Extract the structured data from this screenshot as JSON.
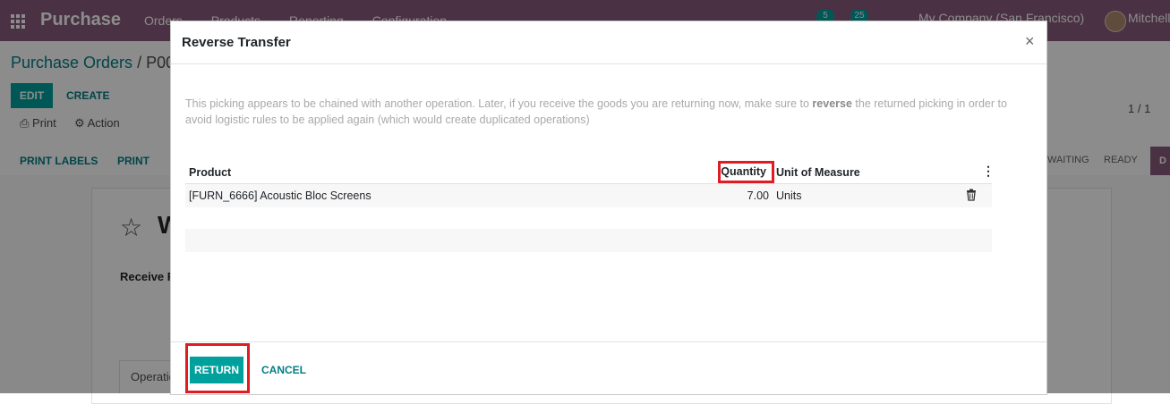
{
  "navbar": {
    "app_name": "Purchase",
    "menu": [
      "Orders",
      "Products",
      "Reporting",
      "Configuration"
    ],
    "messages_count": "5",
    "activities_count": "25",
    "company": "My Company (San Francisco)",
    "user": "Mitchell"
  },
  "control_panel": {
    "breadcrumb_parent": "Purchase Orders",
    "breadcrumb_sep": "/",
    "breadcrumb_current": "P00",
    "edit_label": "EDIT",
    "create_label": "CREATE",
    "print_label": "Print",
    "action_label": "Action",
    "pager": "1 / 1"
  },
  "statusbar": {
    "buttons": [
      "PRINT LABELS",
      "PRINT"
    ],
    "stages": [
      "WAITING",
      "READY",
      "D"
    ]
  },
  "sheet": {
    "title": "W",
    "receive_label": "Receive F",
    "tab_label": "Operatio"
  },
  "modal": {
    "title": "Reverse Transfer",
    "info_before": "This picking appears to be chained with another operation. Later, if you receive the goods you are returning now, make sure to ",
    "info_bold": "reverse",
    "info_after": " the returned picking in order to avoid logistic rules to be applied again (which would create duplicated operations)",
    "table": {
      "columns": [
        "Product",
        "Quantity",
        "Unit of Measure"
      ],
      "rows": [
        {
          "product": "[FURN_6666] Acoustic Bloc Screens",
          "quantity": "7.00",
          "uom": "Units"
        }
      ]
    },
    "return_label": "RETURN",
    "cancel_label": "CANCEL"
  },
  "colors": {
    "navbar": "#875a7b",
    "primary": "#00a09d",
    "highlight": "#e11b22"
  },
  "icons": {
    "apps": "apps-grid-icon",
    "close": "close-icon",
    "options": "vertical-dots-icon",
    "delete": "trash-icon",
    "favorite": "star-icon"
  }
}
